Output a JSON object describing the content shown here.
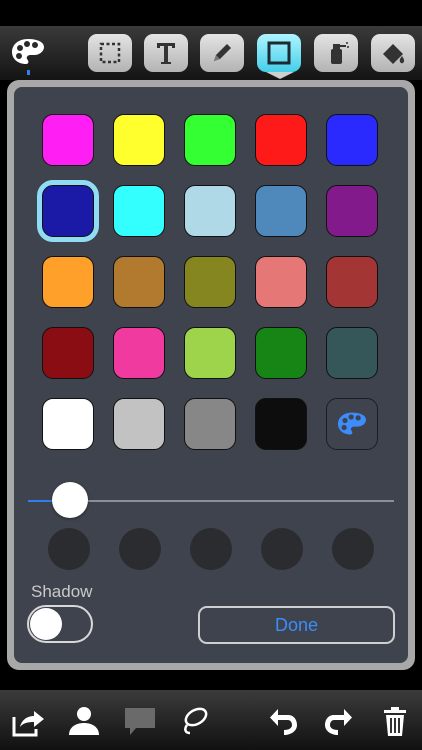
{
  "toolbar": {
    "tools": [
      "palette-icon",
      "selection-icon",
      "text-icon",
      "pencil-icon",
      "shape-icon",
      "spray-icon",
      "fill-icon"
    ],
    "active_tool": "shape-icon"
  },
  "palette": {
    "rows": [
      [
        "#ff1ff5",
        "#ffff2e",
        "#33ff33",
        "#ff1a1a",
        "#2a2aff"
      ],
      [
        "#1a1aa6",
        "#33ffff",
        "#b0d9e8",
        "#4f88bb",
        "#821a8c"
      ],
      [
        "#ffa02a",
        "#b27a2e",
        "#868620",
        "#e67777",
        "#a33535"
      ],
      [
        "#8b0d14",
        "#f03aa0",
        "#9ed44c",
        "#168516",
        "#35575a"
      ],
      [
        "#ffffff",
        "#c2c2c2",
        "#878787",
        "#0d0d0d",
        "custom"
      ]
    ],
    "selected": "#1a1aa6"
  },
  "slider": {
    "value": 0.11
  },
  "shadow": {
    "label": "Shadow",
    "enabled": false
  },
  "done": {
    "label": "Done"
  },
  "bottom": {
    "icons": [
      "share-icon",
      "user-icon",
      "comment-icon",
      "lasso-icon",
      "undo-icon",
      "redo-icon",
      "trash-icon"
    ]
  }
}
